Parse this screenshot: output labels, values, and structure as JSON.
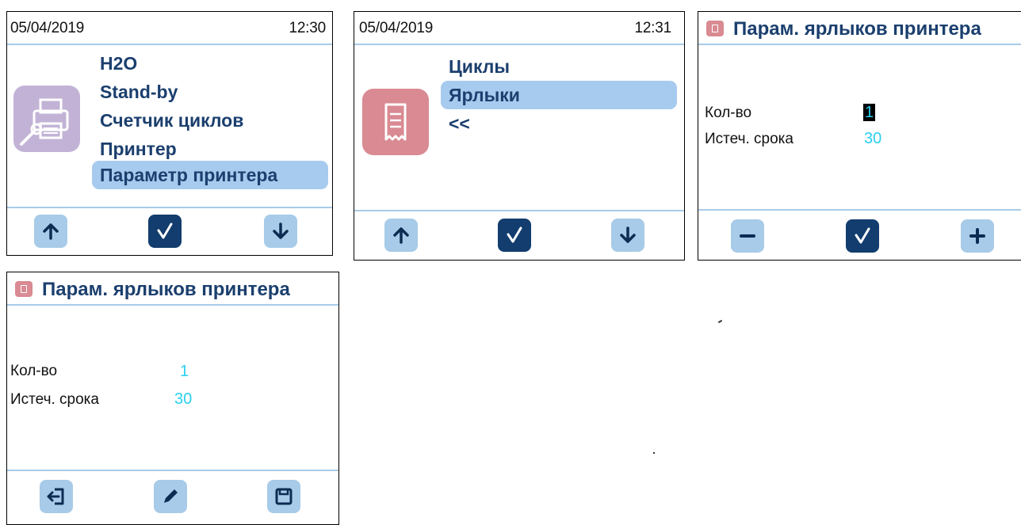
{
  "panel1": {
    "date": "05/04/2019",
    "time": "12:30",
    "icon": "printer-wrench-icon",
    "menu": [
      "H2O",
      "Stand-by",
      "Счетчик циклов",
      "Принтер",
      "Параметр принтера"
    ],
    "selected_index": 4,
    "buttons": [
      "arrow-up-icon",
      "check-icon",
      "arrow-down-icon"
    ]
  },
  "panel2": {
    "date": "05/04/2019",
    "time": "12:31",
    "icon": "receipt-icon",
    "menu": [
      "Циклы",
      "Ярлыки",
      "<<"
    ],
    "selected_index": 1,
    "buttons": [
      "arrow-up-icon",
      "check-icon",
      "arrow-down-icon"
    ]
  },
  "panel3": {
    "title": "Парам. ярлыков принтера",
    "params": [
      {
        "label": "Кол-во",
        "value": "1"
      },
      {
        "label": "Истеч. срока",
        "value": "30"
      }
    ],
    "buttons": [
      "minus-icon",
      "check-icon",
      "plus-icon"
    ]
  },
  "panel4": {
    "title": "Парам. ярлыков принтера",
    "params": [
      {
        "label": "Кол-во",
        "value": "1"
      },
      {
        "label": "Истеч. срока",
        "value": "30"
      }
    ],
    "buttons": [
      "exit-icon",
      "pencil-icon",
      "save-icon"
    ]
  },
  "colors": {
    "accent_light": "#a7cbe8",
    "accent_dark": "#123d6e",
    "menu_text": "#1b3f6e",
    "value_text": "#2ad0f0",
    "icon_purple": "#c2b3d6",
    "icon_pink": "#d98a92"
  }
}
